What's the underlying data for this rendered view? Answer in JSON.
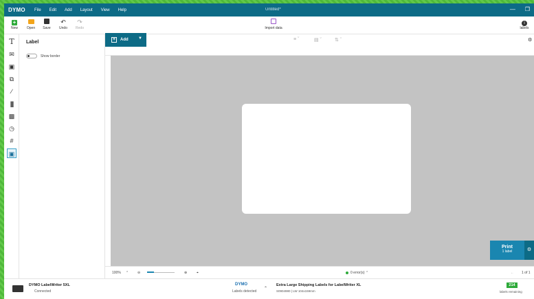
{
  "app": {
    "logo": "DYMO",
    "window_title": "Untitled*",
    "menu": [
      "File",
      "Edit",
      "Add",
      "Layout",
      "View",
      "Help"
    ]
  },
  "toolbar": {
    "new": "New",
    "open": "Open",
    "save": "Save",
    "undo": "Undo",
    "redo": "Redo",
    "import": "Import data",
    "labels": "labels"
  },
  "panel": {
    "title": "Label",
    "show_border": "Show border"
  },
  "canvas": {
    "add": "Add"
  },
  "statusbar": {
    "zoom": "100%",
    "errors": "0 error(s)",
    "pages": "1 of 1"
  },
  "print": {
    "label": "Print",
    "sub": "1 label"
  },
  "footer": {
    "printer_name": "DYMO LabelWriter 5XL",
    "printer_status": "Connected",
    "brand": "DYMO",
    "labels_detected": "Labels detected",
    "label_name": "Extra Large Shipping Labels for LabelWriter XL",
    "label_sku": "S0904980  |  LW 104x159mm",
    "remaining_count": "214",
    "remaining_label": "labels remaining"
  },
  "colors": {
    "titlebar": "#0d6b86",
    "accent": "#1a86b0",
    "workspace": "#c3c3c3",
    "success": "#2eaa3a"
  }
}
